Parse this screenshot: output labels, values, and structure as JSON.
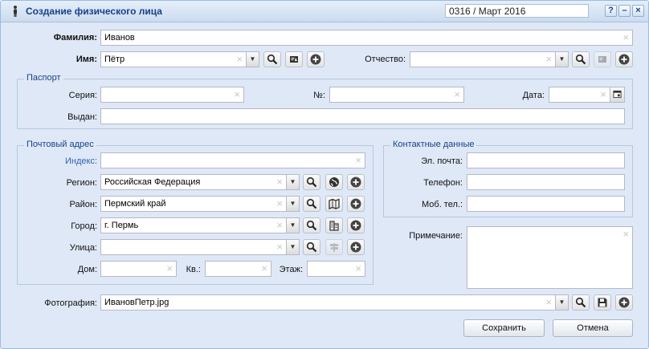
{
  "window": {
    "title": "Создание физического лица",
    "period": "0316 / Март 2016",
    "help_label": "?",
    "minimize_label": "–",
    "close_label": "×"
  },
  "surname": {
    "label": "Фамилия:",
    "value": "Иванов"
  },
  "firstname": {
    "label": "Имя:",
    "value": "Пётр"
  },
  "patronymic": {
    "label": "Отчество:",
    "value": ""
  },
  "passport": {
    "legend": "Паспорт",
    "series_label": "Серия:",
    "series_value": "",
    "number_label": "№:",
    "number_value": "",
    "date_label": "Дата:",
    "date_value": "",
    "issued_label": "Выдан:",
    "issued_value": ""
  },
  "address": {
    "legend": "Почтовый адрес",
    "index_label": "Индекс:",
    "index_value": "",
    "region_label": "Регион:",
    "region_value": "Российская Федерация",
    "district_label": "Район:",
    "district_value": "Пермский край",
    "city_label": "Город:",
    "city_value": "г. Пермь",
    "street_label": "Улица:",
    "street_value": "",
    "house_label": "Дом:",
    "house_value": "",
    "flat_label": "Кв.:",
    "flat_value": "",
    "floor_label": "Этаж:",
    "floor_value": ""
  },
  "contacts": {
    "legend": "Контактные данные",
    "email_label": "Эл. почта:",
    "email_value": "",
    "phone_label": "Телефон:",
    "phone_value": "",
    "mobile_label": "Моб. тел.:",
    "mobile_value": ""
  },
  "note": {
    "label": "Примечание:",
    "value": ""
  },
  "photo": {
    "label": "Фотография:",
    "value": "ИвановПетр.jpg"
  },
  "buttons": {
    "save": "Сохранить",
    "cancel": "Отмена"
  },
  "colors": {
    "title": "#15428b",
    "frame": "#99bbe8",
    "background": "#dfe8f6",
    "link_label": "#2f66b3",
    "add_button": "#444444"
  }
}
